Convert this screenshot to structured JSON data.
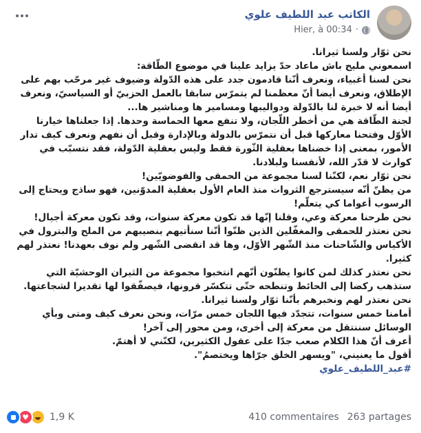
{
  "post": {
    "author": "الكاتب عبد اللطيف علوي",
    "timestamp": "Hier, à 00:34",
    "body_lines": [
      "نحن ثوّار ولسنا ثيرانا.",
      "اسمعوني مليح باش ماعاد حدّ يزايد علينا في موضوع الطّاقة:",
      "نحن لسنا أغبياء، ونعرف أنّنا قادمون جدد على هذه الدّولة وضيوف غير مرحّب بهم على الإطلاق، ونعرف أيضا أنّ معظمنا لم يتمرّس سابقا بالعمل الحزبيّ أو السياسيّ، ونعرف أيضا أنه لا خبرة لنا بالدّولة ودواليبها ومسامير ها ومناشير ها...",
      "لجنة الطّاقة هي من أخطر اللّجان، ولا تنفع معها الحماسة وحدها. إذا جعلناها خيارنا الأوّل وفتحنا معاركها قبل أن نتمرّس بالدولة وبالإدارة وقبل أن نفهم ونعرف كيف تدار الأمور، بمعنى إذا خضناها بعقلية الثّورة فقط وليس بعقلية الدّولة، فقد نتسبّب في كوارث لا قدّر الله، لأنفسنا ولبلادنا.",
      "نحن ثوّار نعم، لكنّنا لسنا مجموعة من الحمقى والفوضويّين!",
      "من يظنّ أنّه سيسترجع الثروات منذ العام الأول بعقلية المدوّنين، فهو ساذج ويحتاج إلى الرسوب أعواما كي يتعلّم!",
      "نحن طرحنا معركة وعي، وقلنا إنّها قد تكون معركة سنوات، وقد تكون معركة أجيال!",
      "نحن نعتذر للحمقى والمغفّلين الذين ظنّوا أنّنا سنأتيهم بنصيبهم من الملح والبترول في الأكياس والشّاحنات منذ الشّهر الأوّل، وها قد انقضى الشّهر ولم نوف بعهدنا! نعتذر لهم كثيرا.",
      "نحن نعتذر كذلك لمن كانوا يظنّون أنّهم انتخبوا مجموعة من الثيران الوحشيّة التي ستذهب ركضا إلى الحائط وتنطحه حتّى تتكسّر قرونها، فيصفّقوا لها تقديرا لشجاعتها. نحن نعتذر لهم ونخبرهم بأنّنا ثوّار ولسنا ثيرانا.",
      "أمامنا خمس سنوات، تتجدّد فيها اللجان خمس مرّات، ونحن نعرف كيف ومتى وبأي الوسائل سننتقل من معركة إلى أخرى، ومن محور إلى آخر!",
      "أعرف أنّ هذا الكلام صعب جدّا على عقول الكثيرين، لكنّني لا أهتمّ.",
      "أقول ما يعنيني، \"ويسهر الخلق جرّاها ويختصمُ\"."
    ],
    "hashtag": "#عبد_اللطيف_علوي",
    "reactions": {
      "icons": [
        "like-icon",
        "love-icon",
        "haha-icon"
      ],
      "count": "1,9 K"
    },
    "comments": "410 commentaires",
    "shares": "263 partages"
  },
  "colors": {
    "link": "#385898",
    "meta": "#616770",
    "like": "#1877f2",
    "love": "#f33e58",
    "haha": "#f7b928"
  }
}
